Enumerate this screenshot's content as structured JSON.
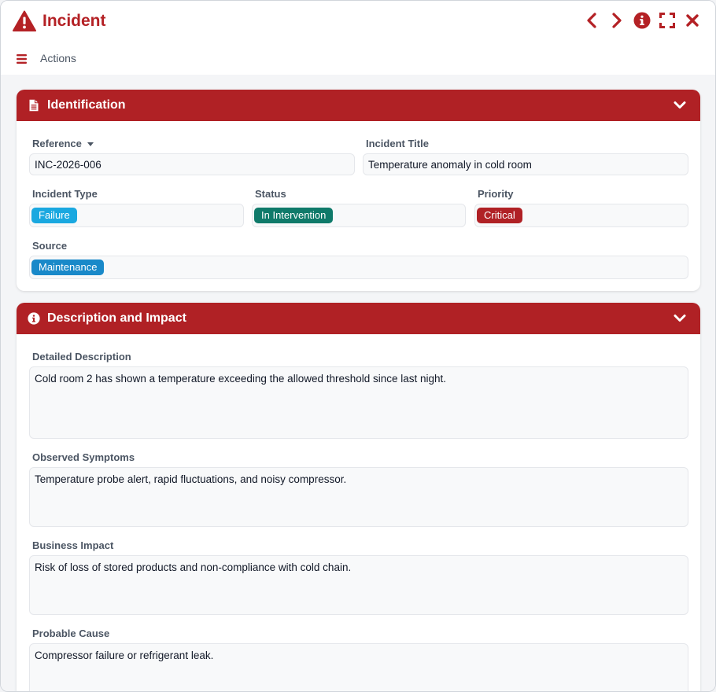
{
  "window": {
    "title": "Incident"
  },
  "toolbar": {
    "actions_label": "Actions"
  },
  "identification": {
    "title": "Identification",
    "reference_label": "Reference",
    "reference_value": "INC-2026-006",
    "title_label": "Incident Title",
    "title_value": "Temperature anomaly in cold room",
    "type_label": "Incident Type",
    "type_value": "Failure",
    "status_label": "Status",
    "status_value": "In Intervention",
    "priority_label": "Priority",
    "priority_value": "Critical",
    "source_label": "Source",
    "source_value": "Maintenance"
  },
  "description": {
    "title": "Description and Impact",
    "detailed_label": "Detailed Description",
    "detailed_value": "Cold room 2 has shown a temperature exceeding the allowed threshold since last night.",
    "symptoms_label": "Observed Symptoms",
    "symptoms_value": "Temperature probe alert, rapid fluctuations, and noisy compressor.",
    "impact_label": "Business Impact",
    "impact_value": "Risk of loss of stored products and non-compliance with cold chain.",
    "cause_label": "Probable Cause",
    "cause_value": "Compressor failure or refrigerant leak."
  },
  "colors": {
    "brand": "#b02125",
    "badge_failure": "#1aa8e0",
    "badge_status": "#0f7a6a",
    "badge_priority": "#b02125",
    "badge_source": "#1989c9"
  },
  "icons": [
    "warning-icon",
    "chevron-left-icon",
    "chevron-right-icon",
    "info-icon",
    "fullscreen-icon",
    "close-icon",
    "menu-icon",
    "document-icon",
    "chevron-down-icon"
  ]
}
